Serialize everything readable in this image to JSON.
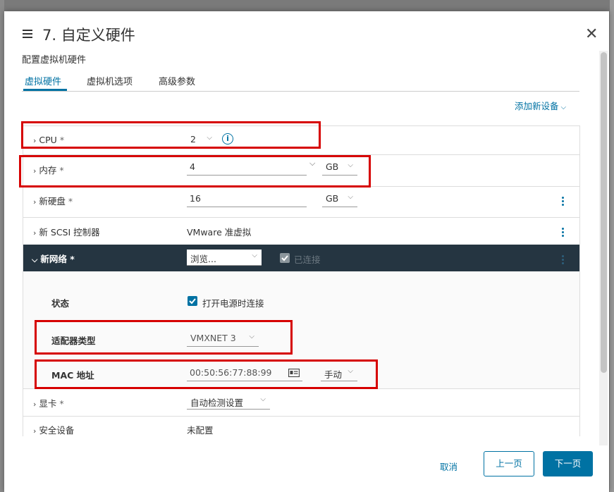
{
  "dialog": {
    "title": "7. 自定义硬件",
    "subtitle": "配置虚拟机硬件",
    "close_glyph": "✕"
  },
  "tabs": [
    {
      "label": "虚拟硬件",
      "active": true
    },
    {
      "label": "虚拟机选项",
      "active": false
    },
    {
      "label": "高级参数",
      "active": false
    }
  ],
  "add_device": {
    "label": "添加新设备",
    "chevron": "⌵"
  },
  "hardware": {
    "cpu": {
      "label": "CPU",
      "req": "*",
      "value": "2"
    },
    "memory": {
      "label": "内存",
      "req": "*",
      "value": "4",
      "unit": "GB"
    },
    "disk": {
      "label": "新硬盘",
      "req": "*",
      "value": "16",
      "unit": "GB"
    },
    "scsi": {
      "label": "新 SCSI 控制器",
      "value": "VMware 准虚拟"
    },
    "network": {
      "label": "新网络",
      "req": "*",
      "browse": "浏览...",
      "connected_label": "已连接",
      "status_label": "状态",
      "power_on_label": "打开电源时连接",
      "adapter_label": "适配器类型",
      "adapter_value": "VMXNET 3",
      "mac_label": "MAC 地址",
      "mac_value": "00:50:56:77:88:99",
      "mac_mode": "手动"
    },
    "video": {
      "label": "显卡",
      "req": "*",
      "value": "自动检测设置"
    },
    "security": {
      "label": "安全设备",
      "value": "未配置"
    }
  },
  "footer": {
    "cancel": "取消",
    "prev": "上一页",
    "next": "下一页"
  },
  "colors": {
    "accent": "#0072a3",
    "network_header": "#253541",
    "highlight_box": "#d60000"
  }
}
